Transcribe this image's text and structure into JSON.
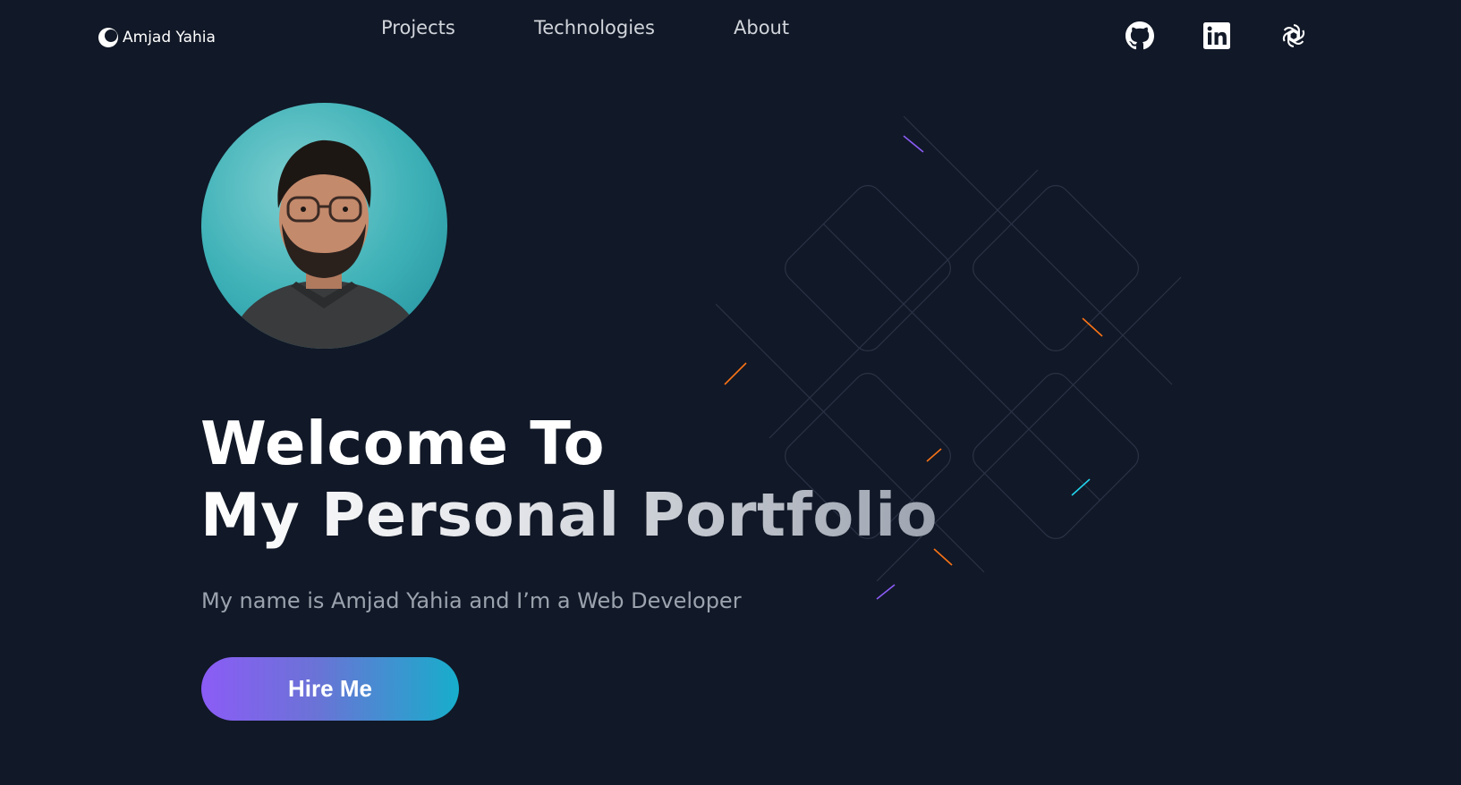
{
  "brand": {
    "name": "Amjad Yahia",
    "logo_icon": "crescent-logo-icon"
  },
  "nav": {
    "links": [
      {
        "label": "Projects"
      },
      {
        "label": "Technologies"
      },
      {
        "label": "About"
      }
    ]
  },
  "socials": [
    {
      "icon": "github-icon"
    },
    {
      "icon": "linkedin-icon"
    },
    {
      "icon": "openai-icon"
    }
  ],
  "hero": {
    "avatar_icon": "profile-photo",
    "headline_line1": "Welcome To",
    "headline_line2": "My Personal Portfolio",
    "subtitle": "My name is Amjad Yahia and I’m a Web Developer",
    "cta_label": "Hire Me"
  },
  "colors": {
    "background": "#111827",
    "text": "#ffffff",
    "nav_text": "#d1d5db",
    "subtitle_text": "#9ca3af",
    "cta_gradient_start": "#8b5cf6",
    "cta_gradient_end": "#17aecb"
  }
}
